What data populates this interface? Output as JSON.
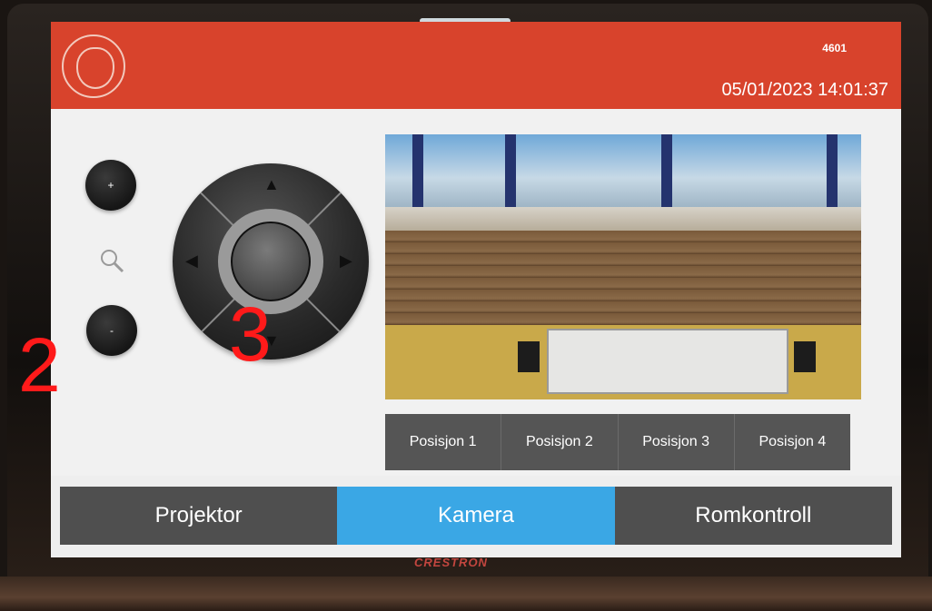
{
  "header": {
    "room_code": "4601",
    "datetime": "05/01/2023 14:01:37",
    "logo_icon": "university-seal-icon"
  },
  "camera_controls": {
    "zoom_in_label": "+",
    "zoom_out_label": "-",
    "zoom_icon": "magnifier-icon",
    "dpad_up": "▲",
    "dpad_down": "▼",
    "dpad_left": "◀",
    "dpad_right": "▶"
  },
  "presets": [
    {
      "label": "Posisjon 1"
    },
    {
      "label": "Posisjon 2"
    },
    {
      "label": "Posisjon 3"
    },
    {
      "label": "Posisjon 4"
    }
  ],
  "tabs": [
    {
      "label": "Projektor",
      "active": false
    },
    {
      "label": "Kamera",
      "active": true
    },
    {
      "label": "Romkontroll",
      "active": false
    }
  ],
  "annotations": {
    "zoom_marker": "2",
    "dpad_marker": "3"
  },
  "device": {
    "brand": "CRESTRON"
  },
  "colors": {
    "header_red": "#d8432c",
    "active_tab_blue": "#3aa7e5",
    "button_grey": "#555555"
  }
}
